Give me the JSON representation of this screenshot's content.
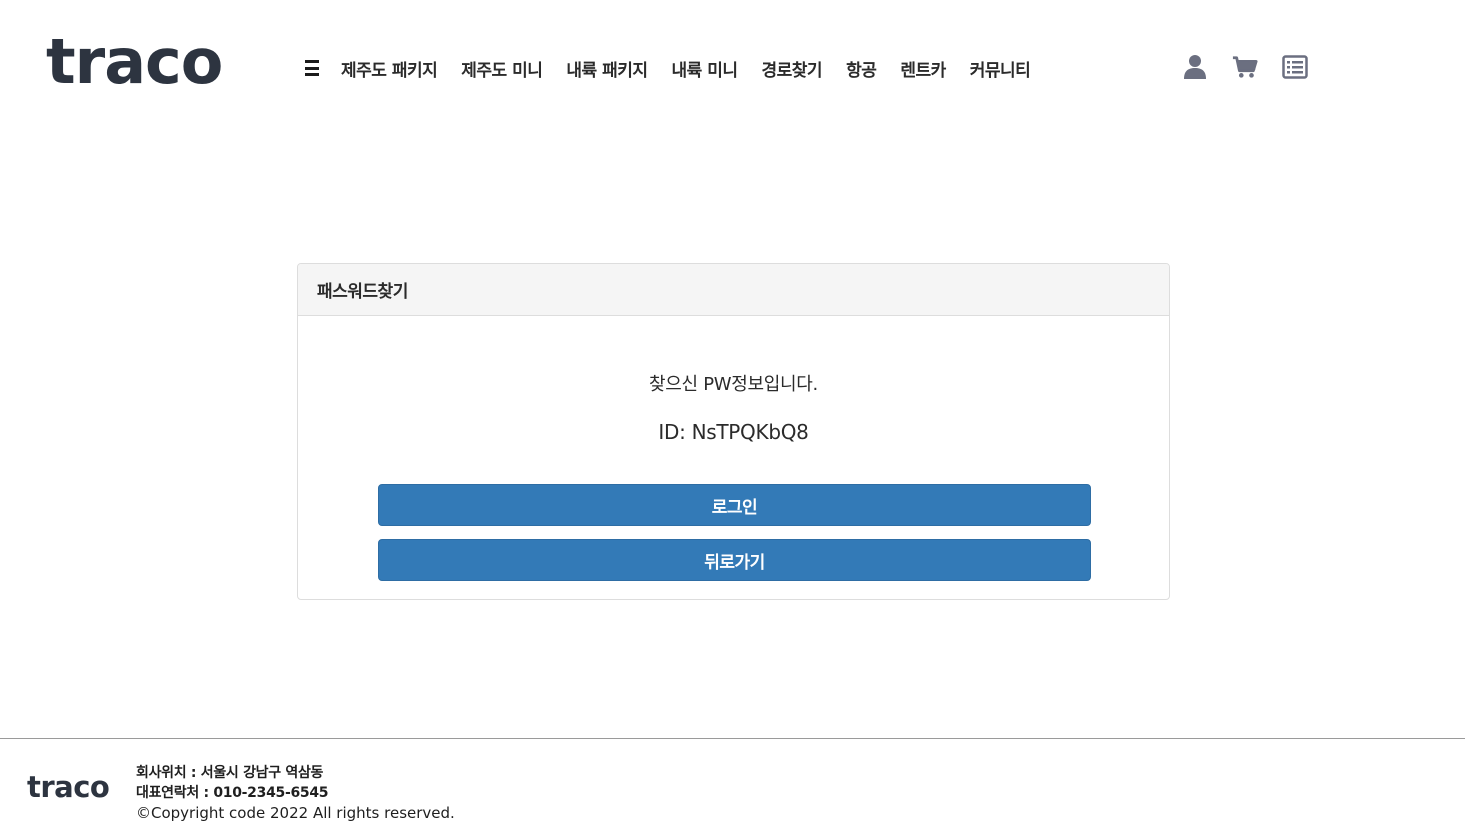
{
  "header": {
    "logo": "traco",
    "nav": [
      {
        "label": "제주도 패키지"
      },
      {
        "label": "제주도 미니"
      },
      {
        "label": "내륙 패키지"
      },
      {
        "label": "내륙 미니"
      },
      {
        "label": "경로찾기"
      },
      {
        "label": "항공"
      },
      {
        "label": "렌트카"
      },
      {
        "label": "커뮤니티"
      }
    ],
    "icons": [
      "user-icon",
      "cart-icon",
      "list-icon"
    ],
    "icon_color": "#6b6f80"
  },
  "card": {
    "title": "패스워드찾기",
    "message": "찾으신 PW정보입니다.",
    "id_line": "ID: NsTPQKbQ8",
    "login_label": "로그인",
    "back_label": "뒤로가기",
    "button_color": "#337ab7"
  },
  "footer": {
    "logo": "traco",
    "address": "회사위치 : 서울시 강남구 역삼동",
    "phone": "대표연락처 : 010-2345-6545",
    "copyright": "©Copyright code 2022 All rights reserved."
  }
}
